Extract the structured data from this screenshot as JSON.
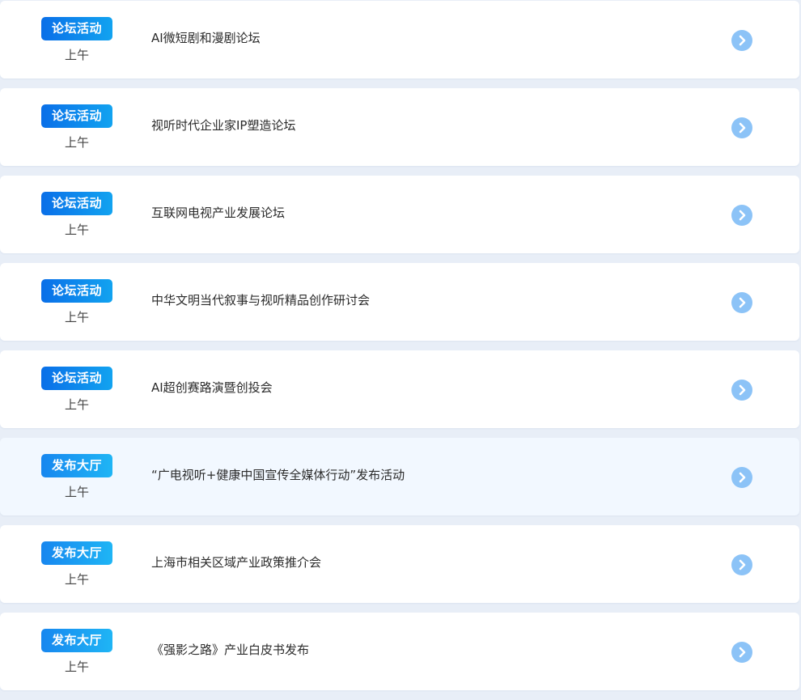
{
  "events": [
    {
      "tag": "论坛活动",
      "tag_type": "forum",
      "time": "上午",
      "title": "AI微短剧和漫剧论坛",
      "highlight": false
    },
    {
      "tag": "论坛活动",
      "tag_type": "forum",
      "time": "上午",
      "title": "视听时代企业家IP塑造论坛",
      "highlight": false
    },
    {
      "tag": "论坛活动",
      "tag_type": "forum",
      "time": "上午",
      "title": "互联网电视产业发展论坛",
      "highlight": false
    },
    {
      "tag": "论坛活动",
      "tag_type": "forum",
      "time": "上午",
      "title": "中华文明当代叙事与视听精品创作研讨会",
      "highlight": false
    },
    {
      "tag": "论坛活动",
      "tag_type": "forum",
      "time": "上午",
      "title": "AI超创赛路演暨创投会",
      "highlight": false
    },
    {
      "tag": "发布大厅",
      "tag_type": "release",
      "time": "上午",
      "title": "“广电视听+健康中国宣传全媒体行动”发布活动",
      "highlight": true
    },
    {
      "tag": "发布大厅",
      "tag_type": "release",
      "time": "上午",
      "title": "上海市相关区域产业政策推介会",
      "highlight": false
    },
    {
      "tag": "发布大厅",
      "tag_type": "release",
      "time": "上午",
      "title": "《强影之路》产业白皮书发布",
      "highlight": false
    }
  ],
  "icons": {
    "row_arrow": "chevron-right-circle-icon"
  },
  "colors": {
    "page_background": "#e8eef7",
    "forum_tag": "#0a6fe8",
    "release_tag": "#1787ef",
    "arrow": "#8cc3f7",
    "highlight_row": "#f2f8ff"
  }
}
